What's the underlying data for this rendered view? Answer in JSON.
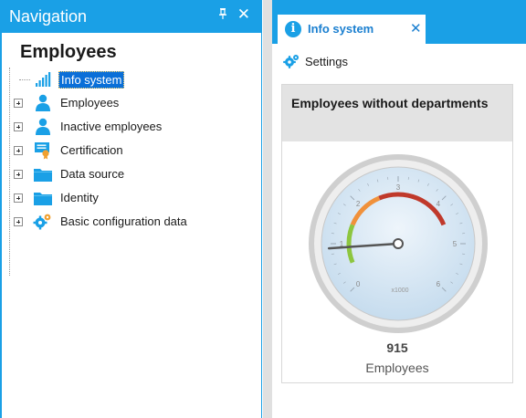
{
  "navigation": {
    "title": "Navigation",
    "pin_glyph": "ꟷ",
    "close_glyph": "✕",
    "heading": "Employees",
    "items": [
      {
        "label": "Info system",
        "icon": "bar-chart-icon",
        "selected": true,
        "expandable": false
      },
      {
        "label": "Employees",
        "icon": "person-icon",
        "expandable": true
      },
      {
        "label": "Inactive employees",
        "icon": "person-icon",
        "expandable": true
      },
      {
        "label": "Certification",
        "icon": "certificate-icon",
        "expandable": true
      },
      {
        "label": "Data source",
        "icon": "folder-icon",
        "expandable": true
      },
      {
        "label": "Identity",
        "icon": "folder-icon",
        "expandable": true
      },
      {
        "label": "Basic configuration data",
        "icon": "gears-icon",
        "expandable": true
      }
    ]
  },
  "document": {
    "tab": {
      "label": "Info system",
      "close_glyph": "✕",
      "info_glyph": "i"
    },
    "toolbar": {
      "settings_label": "Settings"
    },
    "tile": {
      "title": "Employees without departments",
      "value": "915",
      "unit_label": "Employees",
      "gauge": {
        "min": 0,
        "max": 6,
        "multiplier_label": "x1000",
        "tick_labels": [
          "0",
          "1",
          "2",
          "3",
          "4",
          "5",
          "6"
        ],
        "needle_value": 0.915,
        "bands": [
          {
            "from": 0.5,
            "to": 1.5,
            "color": "#8dc63f"
          },
          {
            "from": 1.5,
            "to": 2.5,
            "color": "#f0913b"
          },
          {
            "from": 2.5,
            "to": 4.5,
            "color": "#c0392b"
          }
        ]
      }
    }
  },
  "colors": {
    "accent": "#1aa0e6",
    "selection": "#0a6fd8"
  }
}
